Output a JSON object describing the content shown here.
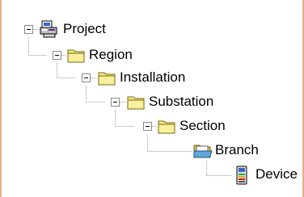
{
  "tree": {
    "project": {
      "label": "Project",
      "expanded": true,
      "icon": "project-icon"
    },
    "region": {
      "label": "Region",
      "expanded": true,
      "icon": "folder-icon"
    },
    "installation": {
      "label": "Installation",
      "expanded": true,
      "icon": "folder-icon"
    },
    "substation": {
      "label": "Substation",
      "expanded": true,
      "icon": "folder-icon"
    },
    "section": {
      "label": "Section",
      "expanded": true,
      "icon": "folder-icon"
    },
    "branch": {
      "label": "Branch",
      "icon": "open-folder-icon"
    },
    "device": {
      "label": "Device",
      "icon": "device-icon"
    }
  },
  "colors": {
    "frame_border": "#e4ae8c",
    "folder": "#f6e98a",
    "tree_line": "#9a9a9a"
  }
}
